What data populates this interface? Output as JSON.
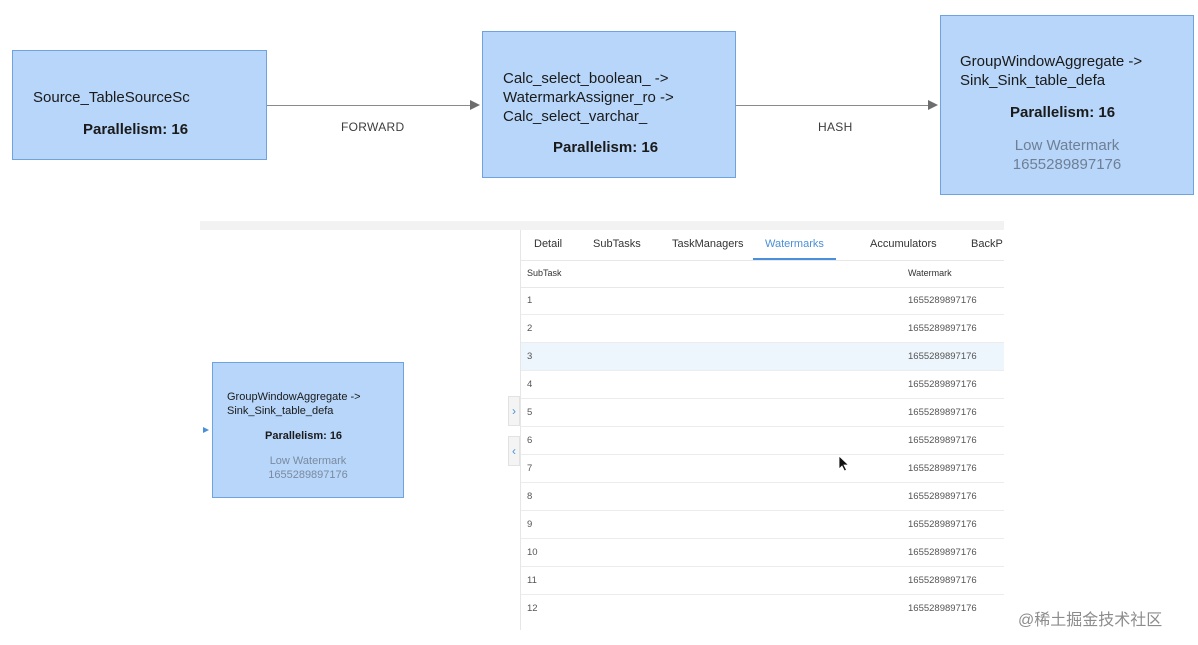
{
  "graph": {
    "nodes": [
      {
        "name": "Source_TableSourceSc",
        "parallelism": "Parallelism: 16"
      },
      {
        "name": "Calc_select_boolean_ -> WatermarkAssigner_ro -> Calc_select_varchar_",
        "parallelism": "Parallelism: 16"
      },
      {
        "name": "GroupWindowAggregate -> Sink_Sink_table_defa",
        "parallelism": "Parallelism: 16",
        "low_watermark_label": "Low Watermark",
        "low_watermark_value": "1655289897176"
      }
    ],
    "edges": [
      {
        "label": "FORWARD"
      },
      {
        "label": "HASH"
      }
    ]
  },
  "selected_node": {
    "name": "GroupWindowAggregate -> Sink_Sink_table_defa",
    "parallelism": "Parallelism: 16",
    "low_watermark_label": "Low Watermark",
    "low_watermark_value": "1655289897176"
  },
  "tabs": [
    {
      "label": "Detail",
      "active": false
    },
    {
      "label": "SubTasks",
      "active": false
    },
    {
      "label": "TaskManagers",
      "active": false
    },
    {
      "label": "Watermarks",
      "active": true
    },
    {
      "label": "Accumulators",
      "active": false
    },
    {
      "label": "BackP",
      "active": false
    }
  ],
  "table": {
    "columns": [
      "SubTask",
      "Watermark"
    ],
    "rows": [
      {
        "subtask": "1",
        "watermark": "1655289897176"
      },
      {
        "subtask": "2",
        "watermark": "1655289897176"
      },
      {
        "subtask": "3",
        "watermark": "1655289897176"
      },
      {
        "subtask": "4",
        "watermark": "1655289897176"
      },
      {
        "subtask": "5",
        "watermark": "1655289897176"
      },
      {
        "subtask": "6",
        "watermark": "1655289897176"
      },
      {
        "subtask": "7",
        "watermark": "1655289897176"
      },
      {
        "subtask": "8",
        "watermark": "1655289897176"
      },
      {
        "subtask": "9",
        "watermark": "1655289897176"
      },
      {
        "subtask": "10",
        "watermark": "1655289897176"
      },
      {
        "subtask": "11",
        "watermark": "1655289897176"
      },
      {
        "subtask": "12",
        "watermark": "1655289897176"
      }
    ],
    "highlighted_row": "3"
  },
  "icons": {
    "expand": "chevron-right-icon",
    "collapse": "chevron-left-icon",
    "cursor": "mouse-pointer-icon"
  },
  "colors": {
    "node_fill": "#b7d6fa",
    "node_border": "#6ea3e0",
    "accent": "#4a90d9",
    "row_highlight": "#edf6fd"
  },
  "brand_watermark": "@稀土掘金技术社区"
}
